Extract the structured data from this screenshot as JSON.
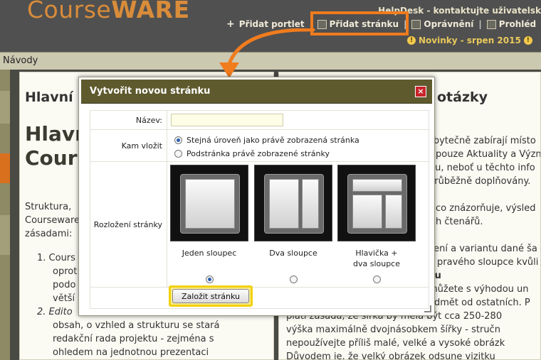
{
  "header": {
    "logo_prefix": "Course",
    "logo_suffix": "WARE",
    "helpdesk": "HelpDesk - kontaktujte uživatelsk",
    "toolbar": {
      "add_portlet": "Přidat portlet",
      "add_page": "Přidat stránku",
      "permissions": "Oprávnění",
      "preview": "Prohléd"
    },
    "news": "Novinky - srpen 2015"
  },
  "nav": {
    "label": "Návody"
  },
  "left_column": {
    "title": "Hlavní",
    "big_title_line1": "Hlavn",
    "big_title_line2": "Cours",
    "para1_line1": "Struktura,",
    "para1_line2": "Courseware",
    "para1_line3": "zásadami:",
    "list_line1": "1. Cours",
    "list_line2": "oprot",
    "list_line3": "podo",
    "list_line4": "větší",
    "list_line5": "2. Edito",
    "list_line6": "obsah, o vzhled a strukturu se stará",
    "list_line7": "redakční rada projektu - zejména s",
    "list_line8": "ohledem na jednotnou prezentaci"
  },
  "right_column": {
    "title": "otázky",
    "l1": "zbytečně zabírají místo",
    "l2": "pouze Aktuality a Význ",
    "l3": "cu, neboť u těchto info",
    "l4": "průběžně doplňovány.",
    "l5": "co znázorňuje, výsled",
    "l6": "h čtenářů.",
    "l7": "čení a variantu dané ša",
    "l8": "pravého sloupce kvůli",
    "l9": "ku",
    "l10": "můžete s výhodou un",
    "l11": "edmět od ostatních. P",
    "l12": "platí zásada, že šířka by měla být cca 250-280",
    "l13": "výška maximálně dvojnásobkem šířky - stručn",
    "l14": "nepoužívejte příliš malé, velké a vysoké obrázk",
    "l15": "Důvodem je, že velký obrázek odsune vizitku"
  },
  "dialog": {
    "title": "Vytvořit novou stránku",
    "close_label": "×",
    "name_label": "Název:",
    "name_value": "",
    "location_label": "Kam vložit",
    "location_options": [
      {
        "label": "Stejná úroveň jako právě zobrazená stránka",
        "selected": true
      },
      {
        "label": "Podstránka právě zobrazené stránky",
        "selected": false
      }
    ],
    "layout_label": "Rozložení stránky",
    "layouts": [
      {
        "label": "Jeden sloupec",
        "selected": true
      },
      {
        "label": "Dva sloupce",
        "selected": false
      },
      {
        "label_line1": "Hlavička +",
        "label_line2": "dva sloupce",
        "selected": false
      }
    ],
    "submit_label": "Založit stránku"
  },
  "colors": {
    "accent_orange": "#f07c1e",
    "dialog_header": "#5f5a2e",
    "highlight_yellow": "#f2d10e"
  }
}
